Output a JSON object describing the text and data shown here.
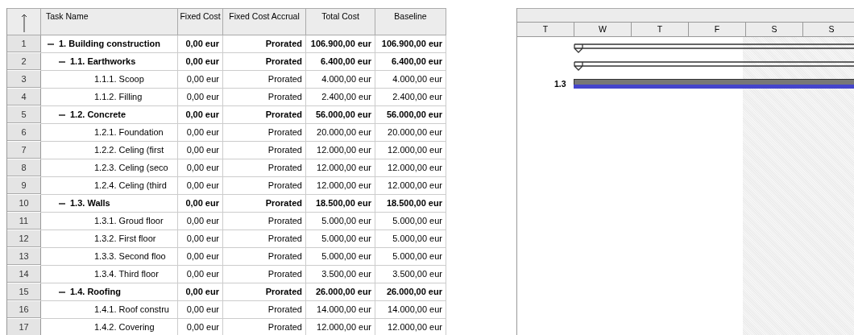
{
  "table": {
    "columns": [
      "Task Name",
      "Fixed Cost",
      "Fixed Cost Accrual",
      "Total Cost",
      "Baseline"
    ],
    "rows": [
      {
        "id": "1",
        "name": "1. Building construction",
        "fixed_cost": "0,00 eur",
        "accrual": "Prorated",
        "total": "106.900,00 eur",
        "baseline": "106.900,00 eur",
        "expanded": true,
        "children": [
          {
            "id": "2",
            "name": "1.1. Earthworks",
            "fixed_cost": "0,00 eur",
            "accrual": "Prorated",
            "total": "6.400,00 eur",
            "baseline": "6.400,00 eur",
            "expanded": true,
            "children": [
              {
                "id": "3",
                "name": "1.1.1. Scoop",
                "fixed_cost": "0,00 eur",
                "accrual": "Prorated",
                "total": "4.000,00 eur",
                "baseline": "4.000,00 eur"
              },
              {
                "id": "4",
                "name": "1.1.2. Filling",
                "fixed_cost": "0,00 eur",
                "accrual": "Prorated",
                "total": "2.400,00 eur",
                "baseline": "2.400,00 eur"
              }
            ]
          },
          {
            "id": "5",
            "name": "1.2. Concrete",
            "fixed_cost": "0,00 eur",
            "accrual": "Prorated",
            "total": "56.000,00 eur",
            "baseline": "56.000,00 eur",
            "expanded": true,
            "children": [
              {
                "id": "6",
                "name": "1.2.1. Foundation",
                "fixed_cost": "0,00 eur",
                "accrual": "Prorated",
                "total": "20.000,00 eur",
                "baseline": "20.000,00 eur"
              },
              {
                "id": "7",
                "name": "1.2.2. Celing (first",
                "fixed_cost": "0,00 eur",
                "accrual": "Prorated",
                "total": "12.000,00 eur",
                "baseline": "12.000,00 eur"
              },
              {
                "id": "8",
                "name": "1.2.3. Celing (seco",
                "fixed_cost": "0,00 eur",
                "accrual": "Prorated",
                "total": "12.000,00 eur",
                "baseline": "12.000,00 eur"
              },
              {
                "id": "9",
                "name": "1.2.4. Celing (third",
                "fixed_cost": "0,00 eur",
                "accrual": "Prorated",
                "total": "12.000,00 eur",
                "baseline": "12.000,00 eur"
              }
            ]
          },
          {
            "id": "10",
            "name": "1.3. Walls",
            "fixed_cost": "0,00 eur",
            "accrual": "Prorated",
            "total": "18.500,00 eur",
            "baseline": "18.500,00 eur",
            "expanded": true,
            "children": [
              {
                "id": "11",
                "name": "1.3.1. Groud floor",
                "fixed_cost": "0,00 eur",
                "accrual": "Prorated",
                "total": "5.000,00 eur",
                "baseline": "5.000,00 eur"
              },
              {
                "id": "12",
                "name": "1.3.2. First floor",
                "fixed_cost": "0,00 eur",
                "accrual": "Prorated",
                "total": "5.000,00 eur",
                "baseline": "5.000,00 eur"
              },
              {
                "id": "13",
                "name": "1.3.3. Second floo",
                "fixed_cost": "0,00 eur",
                "accrual": "Prorated",
                "total": "5.000,00 eur",
                "baseline": "5.000,00 eur"
              },
              {
                "id": "14",
                "name": "1.3.4. Third floor",
                "fixed_cost": "0,00 eur",
                "accrual": "Prorated",
                "total": "3.500,00 eur",
                "baseline": "3.500,00 eur"
              }
            ]
          },
          {
            "id": "15",
            "name": "1.4. Roofing",
            "fixed_cost": "0,00 eur",
            "accrual": "Prorated",
            "total": "26.000,00 eur",
            "baseline": "26.000,00 eur",
            "expanded": true,
            "children": [
              {
                "id": "16",
                "name": "1.4.1. Roof constru",
                "fixed_cost": "0,00 eur",
                "accrual": "Prorated",
                "total": "14.000,00 eur",
                "baseline": "14.000,00 eur"
              },
              {
                "id": "17",
                "name": "1.4.2. Covering",
                "fixed_cost": "0,00 eur",
                "accrual": "Prorated",
                "total": "12.000,00 eur",
                "baseline": "12.000,00 eur"
              }
            ]
          }
        ]
      }
    ]
  },
  "gantt": {
    "days": [
      "T",
      "W",
      "T",
      "F",
      "S",
      "S"
    ],
    "bars": [
      {
        "kind": "summary"
      },
      {
        "kind": "summary"
      },
      {
        "kind": "task",
        "label": "1.3"
      }
    ]
  }
}
